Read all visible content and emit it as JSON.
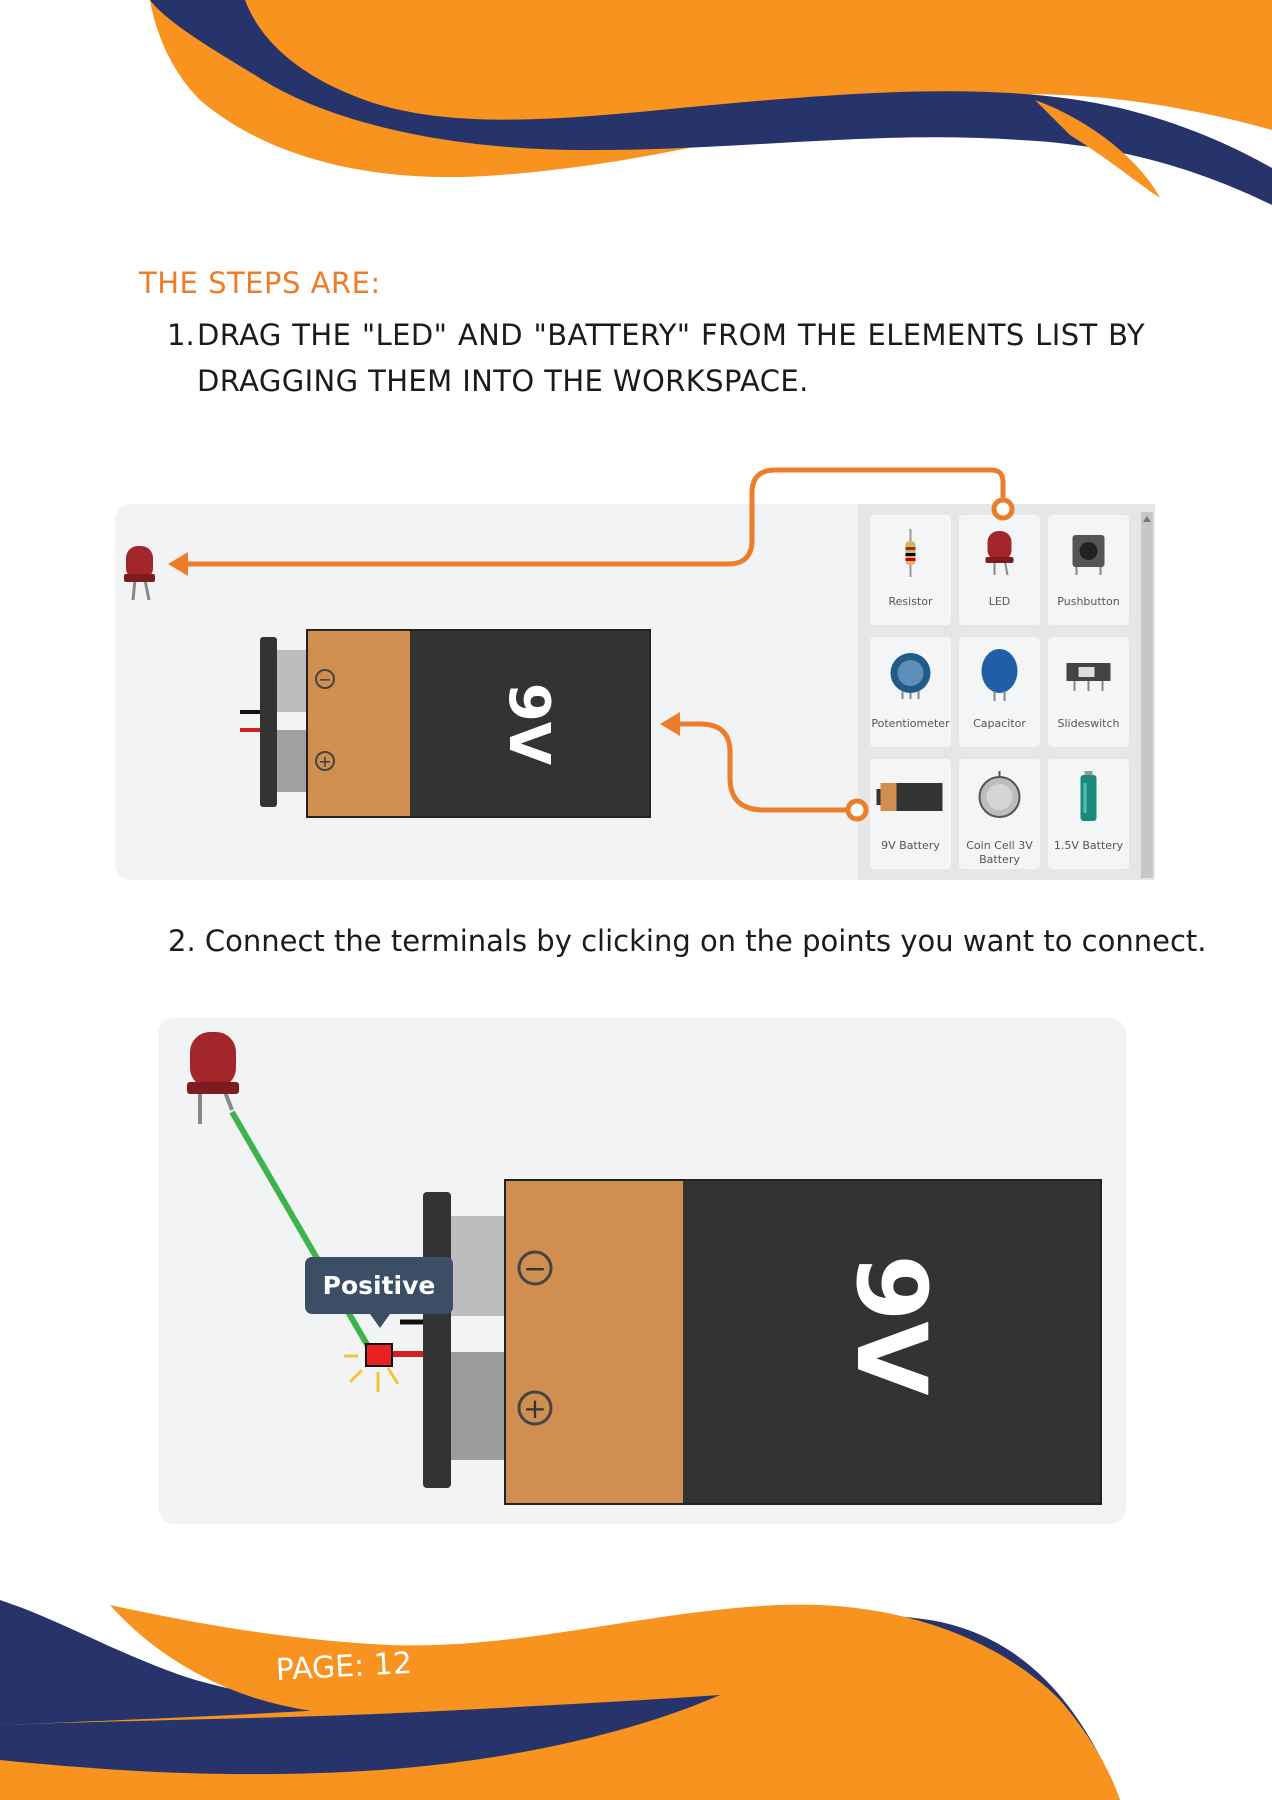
{
  "heading": "THE STEPS ARE:",
  "steps": [
    {
      "number": "1.",
      "text": "DRAG THE \"LED\" AND \"BATTERY\" FROM THE ELEMENTS LIST BY DRAGGING THEM INTO THE WORKSPACE."
    },
    {
      "number": "2.",
      "text": "Connect the terminals by clicking on the points you want to connect."
    }
  ],
  "figure1": {
    "battery_label": "9V",
    "minus_symbol": "−",
    "plus_symbol": "+",
    "components": [
      {
        "label": "Resistor",
        "icon": "resistor-icon"
      },
      {
        "label": "LED",
        "icon": "led-icon"
      },
      {
        "label": "Pushbutton",
        "icon": "pushbutton-icon"
      },
      {
        "label": "Potentiometer",
        "icon": "potentiometer-icon"
      },
      {
        "label": "Capacitor",
        "icon": "capacitor-icon"
      },
      {
        "label": "Slideswitch",
        "icon": "slideswitch-icon"
      },
      {
        "label": "9V Battery",
        "icon": "battery-9v-icon"
      },
      {
        "label": "Coin Cell 3V",
        "label2": "Battery",
        "icon": "coin-cell-icon"
      },
      {
        "label": "1.5V Battery",
        "icon": "battery-aa-icon"
      }
    ]
  },
  "figure2": {
    "battery_label": "9V",
    "tooltip": "Positive",
    "minus_symbol": "−",
    "plus_symbol": "+"
  },
  "footer": {
    "page_label": "PAGE: 12"
  },
  "colors": {
    "orange": "#f7931e",
    "navy": "#27336b",
    "accent_orange": "#ee7d2a",
    "wire_green": "#3cb44b",
    "battery_tan": "#d08e50",
    "battery_dark": "#333333"
  }
}
